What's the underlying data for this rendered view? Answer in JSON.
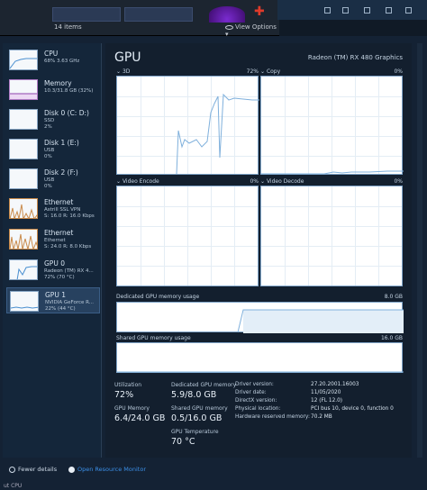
{
  "explorer": {
    "item_count": "14 items",
    "view_options": "View Options"
  },
  "header": {
    "title": "GPU",
    "model": "Radeon (TM) RX 480 Graphics"
  },
  "sidebar": {
    "items": [
      {
        "name": "CPU",
        "sub1": "68% 3.63 GHz",
        "sub2": ""
      },
      {
        "name": "Memory",
        "sub1": "10.3/31.8 GB (32%)",
        "sub2": ""
      },
      {
        "name": "Disk 0 (C: D:)",
        "sub1": "SSD",
        "sub2": "2%"
      },
      {
        "name": "Disk 1 (E:)",
        "sub1": "USB",
        "sub2": "0%"
      },
      {
        "name": "Disk 2 (F:)",
        "sub1": "USB",
        "sub2": "0%"
      },
      {
        "name": "Ethernet",
        "sub1": "Astrill SSL VPN",
        "sub2": "S: 16.0 R: 16.0 Kbps"
      },
      {
        "name": "Ethernet",
        "sub1": "Ethernet",
        "sub2": "S: 24.0 R: 8.0 Kbps"
      },
      {
        "name": "GPU 0",
        "sub1": "Radeon (TM) RX 4...",
        "sub2": "72% (70 °C)"
      },
      {
        "name": "GPU 1",
        "sub1": "NVIDIA GeForce R...",
        "sub2": "22% (44 °C)"
      }
    ]
  },
  "graphs": {
    "g3d": {
      "label": "3D",
      "pct": "72%"
    },
    "copy": {
      "label": "Copy",
      "pct": "0%"
    },
    "venc": {
      "label": "Video Encode",
      "pct": "0%"
    },
    "vdec": {
      "label": "Video Decode",
      "pct": "0%"
    },
    "dedicated": {
      "label": "Dedicated GPU memory usage",
      "max": "8.0 GB"
    },
    "shared": {
      "label": "Shared GPU memory usage",
      "max": "16.0 GB"
    }
  },
  "stats": {
    "utilization_label": "Utilization",
    "utilization": "72%",
    "dedicated_label": "Dedicated GPU memory",
    "dedicated": "5.9/8.0 GB",
    "gpu_memory_label": "GPU Memory",
    "gpu_memory": "6.4/24.0 GB",
    "shared_label": "Shared GPU memory",
    "shared": "0.5/16.0 GB",
    "temp_label": "GPU Temperature",
    "temp": "70 °C"
  },
  "details": [
    {
      "key": "Driver version:",
      "val": "27.20.2001.16003"
    },
    {
      "key": "Driver date:",
      "val": "11/05/2020"
    },
    {
      "key": "DirectX version:",
      "val": "12 (FL 12.0)"
    },
    {
      "key": "Physical location:",
      "val": "PCI bus 10, device 0, function 0"
    },
    {
      "key": "Hardware reserved memory:",
      "val": "70.2 MB"
    }
  ],
  "footer": {
    "fewer_details": "Fewer details",
    "open_monitor": "Open Resource Monitor",
    "bottom_text": "ut CPU"
  },
  "colors": {
    "accent": "#3b8ee6",
    "graph_line": "#7fb0dc",
    "graph_bg": "#ffffff"
  }
}
